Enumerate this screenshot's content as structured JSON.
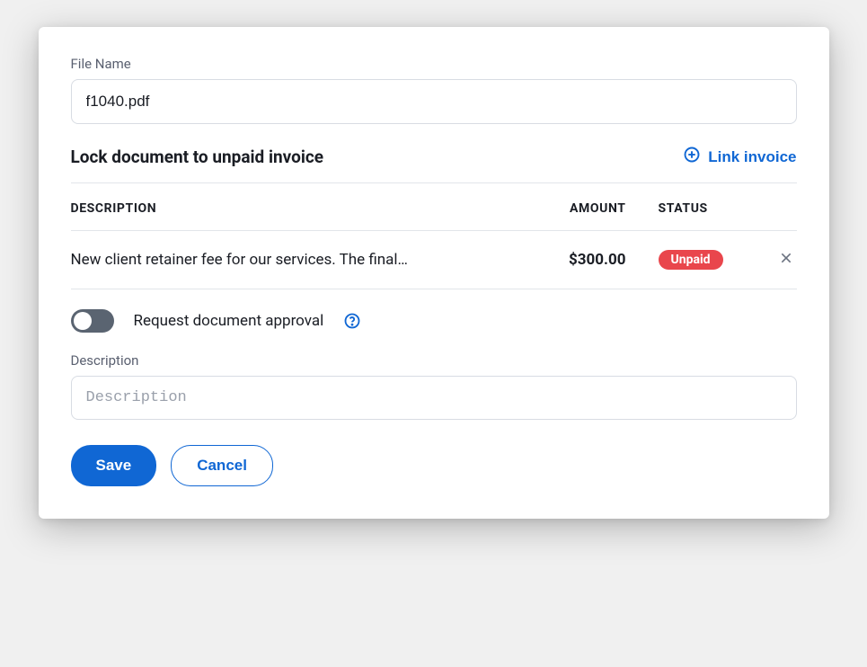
{
  "fileName": {
    "label": "File Name",
    "value": "f1040.pdf"
  },
  "lockSection": {
    "title": "Lock document to unpaid invoice",
    "linkButton": "Link invoice"
  },
  "invoiceTable": {
    "headers": {
      "description": "DESCRIPTION",
      "amount": "AMOUNT",
      "status": "STATUS"
    },
    "rows": [
      {
        "description": "New client retainer fee for our services. The final…",
        "amount": "$300.00",
        "status": "Unpaid"
      }
    ]
  },
  "approval": {
    "label": "Request document approval",
    "toggled": false
  },
  "description": {
    "label": "Description",
    "placeholder": "Description",
    "value": ""
  },
  "buttons": {
    "save": "Save",
    "cancel": "Cancel"
  }
}
